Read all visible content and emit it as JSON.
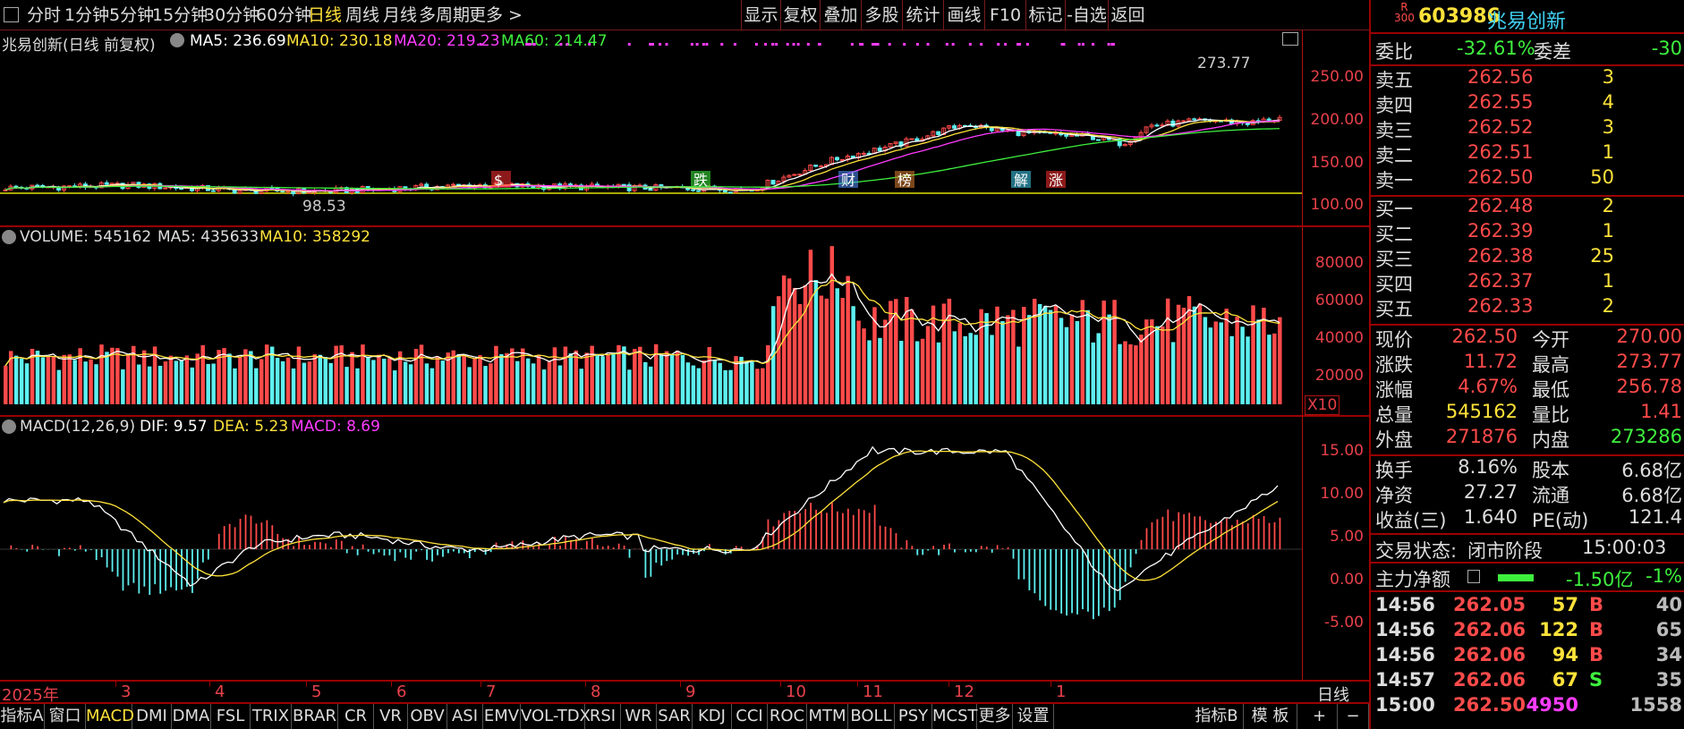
{
  "toolbar": {
    "left_items": [
      "分时",
      "1分钟",
      "5分钟",
      "15分钟",
      "30分钟",
      "60分钟",
      "日线",
      "周线",
      "月线",
      "多周期",
      "更多 >"
    ],
    "active": "日线",
    "right_items": [
      "显示",
      "复权",
      "叠加",
      "多股",
      "统计",
      "画线",
      "F10",
      "标记",
      "-自选",
      "返回"
    ]
  },
  "kline": {
    "title": "兆易创新(日线 前复权)",
    "ma5": "MA5: 236.69",
    "ma10": "MA10: 230.18",
    "ma20": "MA20: 219.23",
    "ma60": "MA60: 214.47",
    "high_label": "273.77",
    "low_label": "98.53",
    "axis": [
      "250.00",
      "200.00",
      "150.00",
      "100.00"
    ],
    "events": [
      "$",
      "跌",
      "财",
      "榜",
      "解",
      "涨"
    ]
  },
  "volume": {
    "title": "VOLUME: 545162",
    "ma5": "MA5: 435633",
    "ma10": "MA10: 358292",
    "axis": [
      "80000",
      "60000",
      "40000",
      "20000"
    ],
    "unit": "X10"
  },
  "macd": {
    "title": "MACD(12,26,9)",
    "dif": "DIF: 9.57",
    "dea": "DEA: 5.23",
    "macd": "MACD: 8.69",
    "axis": [
      "15.00",
      "10.00",
      "5.00",
      "0.00",
      "-5.00"
    ]
  },
  "dates": {
    "labels": [
      "2025年",
      "3",
      "4",
      "5",
      "6",
      "7",
      "8",
      "9",
      "10",
      "11",
      "12",
      "1"
    ],
    "period": "日线"
  },
  "bottom": {
    "tabs": [
      "指标A",
      "窗口",
      "MACD",
      "DMI",
      "DMA",
      "FSL",
      "TRIX",
      "BRAR",
      "CR",
      "VR",
      "OBV",
      "ASI",
      "EMV",
      "VOL-TDX",
      "RSI",
      "WR",
      "SAR",
      "KDJ",
      "CCI",
      "ROC",
      "MTM",
      "BOLL",
      "PSY",
      "MCST",
      "更多",
      "设置"
    ],
    "active": "MACD",
    "right_tabs": [
      "指标B",
      "模 板",
      "+",
      "−"
    ]
  },
  "quote": {
    "badge_top": "R",
    "badge_bottom": "300",
    "code": "603986",
    "name": "兆易创新",
    "weibi_label": "委比",
    "weibi": "-32.61%",
    "weicha_label": "委差",
    "weicha": "-30",
    "asks": [
      {
        "label": "卖五",
        "price": "262.56",
        "vol": "3"
      },
      {
        "label": "卖四",
        "price": "262.55",
        "vol": "4"
      },
      {
        "label": "卖三",
        "price": "262.52",
        "vol": "3"
      },
      {
        "label": "卖二",
        "price": "262.51",
        "vol": "1"
      },
      {
        "label": "卖一",
        "price": "262.50",
        "vol": "50"
      }
    ],
    "bids": [
      {
        "label": "买一",
        "price": "262.48",
        "vol": "2"
      },
      {
        "label": "买二",
        "price": "262.39",
        "vol": "1"
      },
      {
        "label": "买三",
        "price": "262.38",
        "vol": "25"
      },
      {
        "label": "买四",
        "price": "262.37",
        "vol": "1"
      },
      {
        "label": "买五",
        "price": "262.33",
        "vol": "2"
      }
    ],
    "stats": [
      {
        "l1": "现价",
        "v1": "262.50",
        "c1": "red",
        "l2": "今开",
        "v2": "270.00",
        "c2": "red"
      },
      {
        "l1": "涨跌",
        "v1": "11.72",
        "c1": "red",
        "l2": "最高",
        "v2": "273.77",
        "c2": "red"
      },
      {
        "l1": "涨幅",
        "v1": "4.67%",
        "c1": "red",
        "l2": "最低",
        "v2": "256.78",
        "c2": "red"
      },
      {
        "l1": "总量",
        "v1": "545162",
        "c1": "yel",
        "l2": "量比",
        "v2": "1.41",
        "c2": "red"
      },
      {
        "l1": "外盘",
        "v1": "271876",
        "c1": "red",
        "l2": "内盘",
        "v2": "273286",
        "c2": "grn"
      }
    ],
    "stats2": [
      {
        "l1": "换手",
        "v1": "8.16%",
        "l2": "股本",
        "v2": "6.68亿"
      },
      {
        "l1": "净资",
        "v1": "27.27",
        "l2": "流通",
        "v2": "6.68亿"
      },
      {
        "l1": "收益(三)",
        "v1": "1.640",
        "l2": "PE(动)",
        "v2": "121.4"
      }
    ],
    "status_label": "交易状态:",
    "status": "闭市阶段",
    "status_time": "15:00:03",
    "flow_label": "主力净额",
    "flow_value": "-1.50亿",
    "flow_pct": "-1%",
    "ticks": [
      {
        "t": "14:56",
        "p": "262.05",
        "v": "57",
        "vc": "yel",
        "s": "B",
        "sc": "red",
        "n": "40"
      },
      {
        "t": "14:56",
        "p": "262.06",
        "v": "122",
        "vc": "yel",
        "s": "B",
        "sc": "red",
        "n": "65"
      },
      {
        "t": "14:56",
        "p": "262.06",
        "v": "94",
        "vc": "yel",
        "s": "B",
        "sc": "red",
        "n": "34"
      },
      {
        "t": "14:57",
        "p": "262.06",
        "v": "67",
        "vc": "yel",
        "s": "S",
        "sc": "grn",
        "n": "35"
      },
      {
        "t": "15:00",
        "p": "262.50",
        "v": "4950",
        "vc": "mag",
        "s": "",
        "sc": "red",
        "n": "1558"
      }
    ]
  },
  "colors": {
    "up": "#ff4a4a",
    "down": "#5ef0f0",
    "ma5": "#ffffff",
    "ma10": "#ffe23a",
    "ma20": "#ff3cff",
    "ma60": "#3ef03e",
    "grid": "#9a0000"
  }
}
